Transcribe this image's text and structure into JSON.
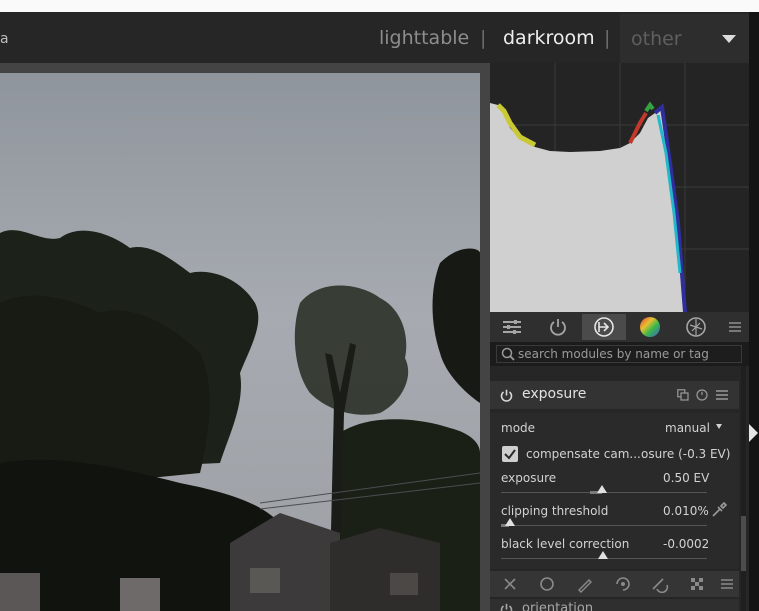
{
  "header": {
    "lead_fragment": "a",
    "views": {
      "lighttable": "lighttable",
      "separator": "|",
      "darkroom": "darkroom",
      "other": "other"
    }
  },
  "module_group_tabs": [
    {
      "icon": "quick-access-icon",
      "active": false
    },
    {
      "icon": "active-modules-power-icon",
      "active": false
    },
    {
      "icon": "base-modules-icon",
      "active": true
    },
    {
      "icon": "color-wheel-icon",
      "active": false
    },
    {
      "icon": "effects-icon",
      "active": false
    },
    {
      "icon": "presets-menu-icon",
      "active": false
    }
  ],
  "search": {
    "placeholder": "search modules by name or tag"
  },
  "exposure_module": {
    "title": "exposure",
    "mode_label": "mode",
    "mode_value": "manual",
    "compensate_label": "compensate cam...",
    "compensate_value": "osure (-0.3 EV)",
    "compensate_checked": true,
    "exposure_label": "exposure",
    "exposure_value": "0.50 EV",
    "clipping_label": "clipping threshold",
    "clipping_value": "0.010%",
    "black_label": "black level correction",
    "black_value": "-0.0002"
  },
  "next_module": {
    "title": "orientation"
  },
  "colors": {
    "accent_active_tab": "#4b4b4b",
    "panel": "#262626",
    "header": "#262626"
  }
}
